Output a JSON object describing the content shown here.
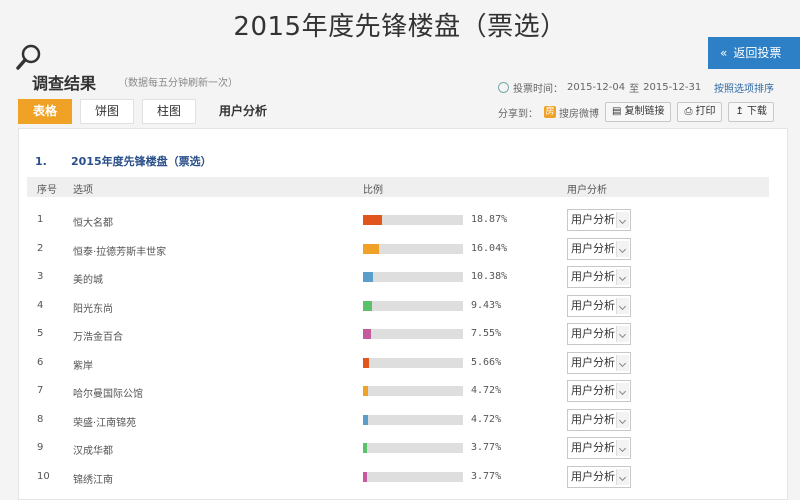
{
  "page_title": "2015年度先锋楼盘（票选）",
  "back_button": "返回投票",
  "result": {
    "label": "调查结果",
    "note": "（数据每五分钟刷新一次）"
  },
  "vote_time": {
    "label": "投票时间：",
    "start": "2015-12-04",
    "sep": "至",
    "end": "2015-12-31"
  },
  "sort_link": "按照选项排序",
  "tabs": [
    "表格",
    "饼图",
    "柱图",
    "用户分析"
  ],
  "share": {
    "label": "分享到：",
    "weibo": "搜房微博",
    "copy": "复制链接",
    "print": "打印",
    "download": "下载"
  },
  "question": {
    "number": "1.",
    "title": "2015年度先锋楼盘（票选）"
  },
  "table_headers": {
    "idx": "序号",
    "option": "选项",
    "ratio": "比例",
    "analysis": "用户分析"
  },
  "select_label": "用户分析",
  "rows": [
    {
      "idx": "1",
      "option": "恒大名都",
      "pct_text": "18.87%",
      "pct": 18.87,
      "color": "#e0561b"
    },
    {
      "idx": "2",
      "option": "恒泰·拉德芳斯丰世家",
      "pct_text": "16.04%",
      "pct": 16.04,
      "color": "#f0a226"
    },
    {
      "idx": "3",
      "option": "美的城",
      "pct_text": "10.38%",
      "pct": 10.38,
      "color": "#5a9ec9"
    },
    {
      "idx": "4",
      "option": "阳光东尚",
      "pct_text": "9.43%",
      "pct": 9.43,
      "color": "#5dc06a"
    },
    {
      "idx": "5",
      "option": "万浩金百合",
      "pct_text": "7.55%",
      "pct": 7.55,
      "color": "#c45b9c"
    },
    {
      "idx": "6",
      "option": "紫岸",
      "pct_text": "5.66%",
      "pct": 5.66,
      "color": "#e0561b"
    },
    {
      "idx": "7",
      "option": "哈尔曼国际公馆",
      "pct_text": "4.72%",
      "pct": 4.72,
      "color": "#f0a226"
    },
    {
      "idx": "8",
      "option": "荣盛·江南锦苑",
      "pct_text": "4.72%",
      "pct": 4.72,
      "color": "#5a9ec9"
    },
    {
      "idx": "9",
      "option": "汉成华都",
      "pct_text": "3.77%",
      "pct": 3.77,
      "color": "#5dc06a"
    },
    {
      "idx": "10",
      "option": "锦绣江南",
      "pct_text": "3.77%",
      "pct": 3.77,
      "color": "#c45b9c"
    }
  ]
}
